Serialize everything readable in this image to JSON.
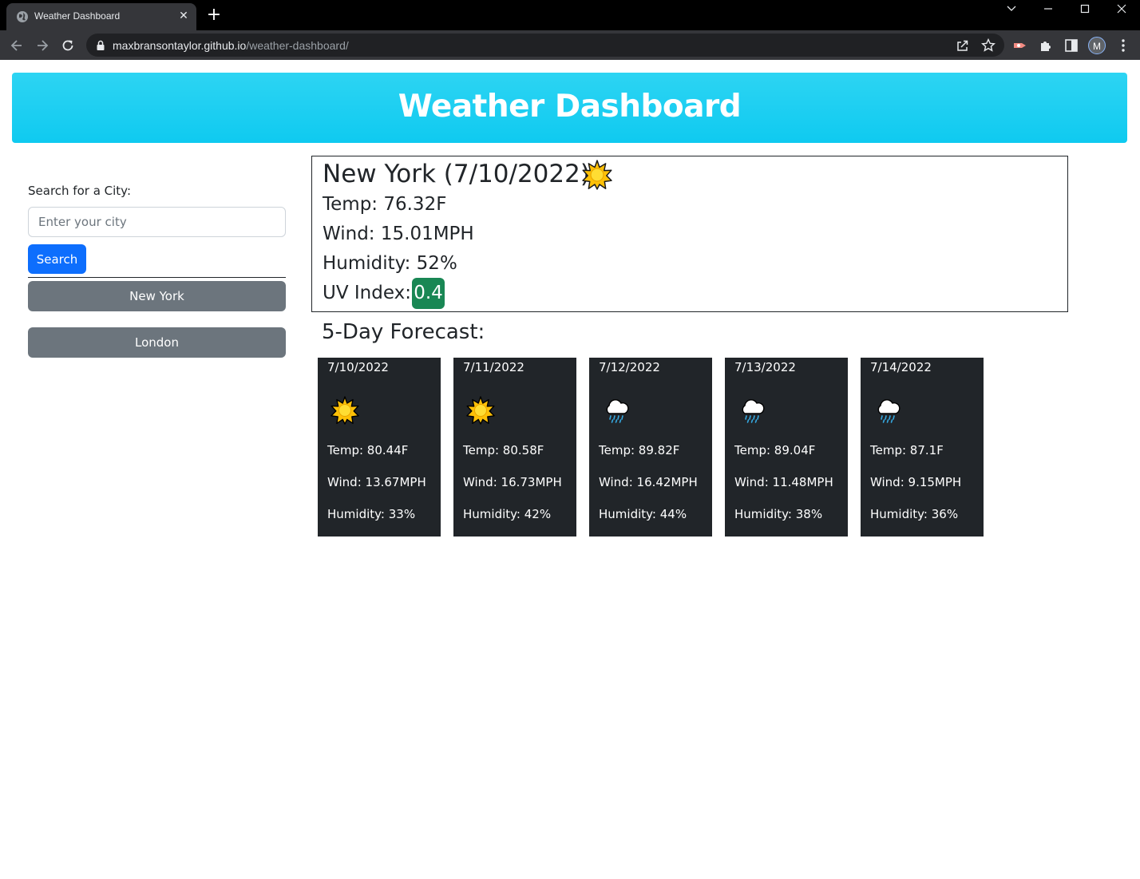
{
  "browser": {
    "tab_title": "Weather Dashboard",
    "url_host": "maxbransontaylor.github.io",
    "url_path": "/weather-dashboard/",
    "profile_initial": "M"
  },
  "page": {
    "title": "Weather Dashboard",
    "search": {
      "label": "Search for a City:",
      "placeholder": "Enter your city",
      "value": "",
      "button_label": "Search"
    },
    "history": [
      "New York",
      "London"
    ],
    "current": {
      "heading": "New York (7/10/2022)",
      "icon": "sun-icon",
      "temp": "Temp: 76.32F",
      "wind": "Wind: 15.01MPH",
      "humidity": "Humidity: 52%",
      "uv_label": "UV Index:",
      "uv_value": "0.4",
      "uv_color": "#198754"
    },
    "forecast_title": "5-Day Forecast:",
    "forecast": [
      {
        "date": "7/10/2022",
        "icon": "sun-icon",
        "temp": "Temp: 80.44F",
        "wind": "Wind: 13.67MPH",
        "humidity": "Humidity: 33%"
      },
      {
        "date": "7/11/2022",
        "icon": "sun-icon",
        "temp": "Temp: 80.58F",
        "wind": "Wind: 16.73MPH",
        "humidity": "Humidity: 42%"
      },
      {
        "date": "7/12/2022",
        "icon": "rain-cloud-icon",
        "temp": "Temp: 89.82F",
        "wind": "Wind: 16.42MPH",
        "humidity": "Humidity: 44%"
      },
      {
        "date": "7/13/2022",
        "icon": "rain-cloud-icon",
        "temp": "Temp: 89.04F",
        "wind": "Wind: 11.48MPH",
        "humidity": "Humidity: 38%"
      },
      {
        "date": "7/14/2022",
        "icon": "rain-cloud-icon",
        "temp": "Temp: 87.1F",
        "wind": "Wind: 9.15MPH",
        "humidity": "Humidity: 36%"
      }
    ]
  }
}
